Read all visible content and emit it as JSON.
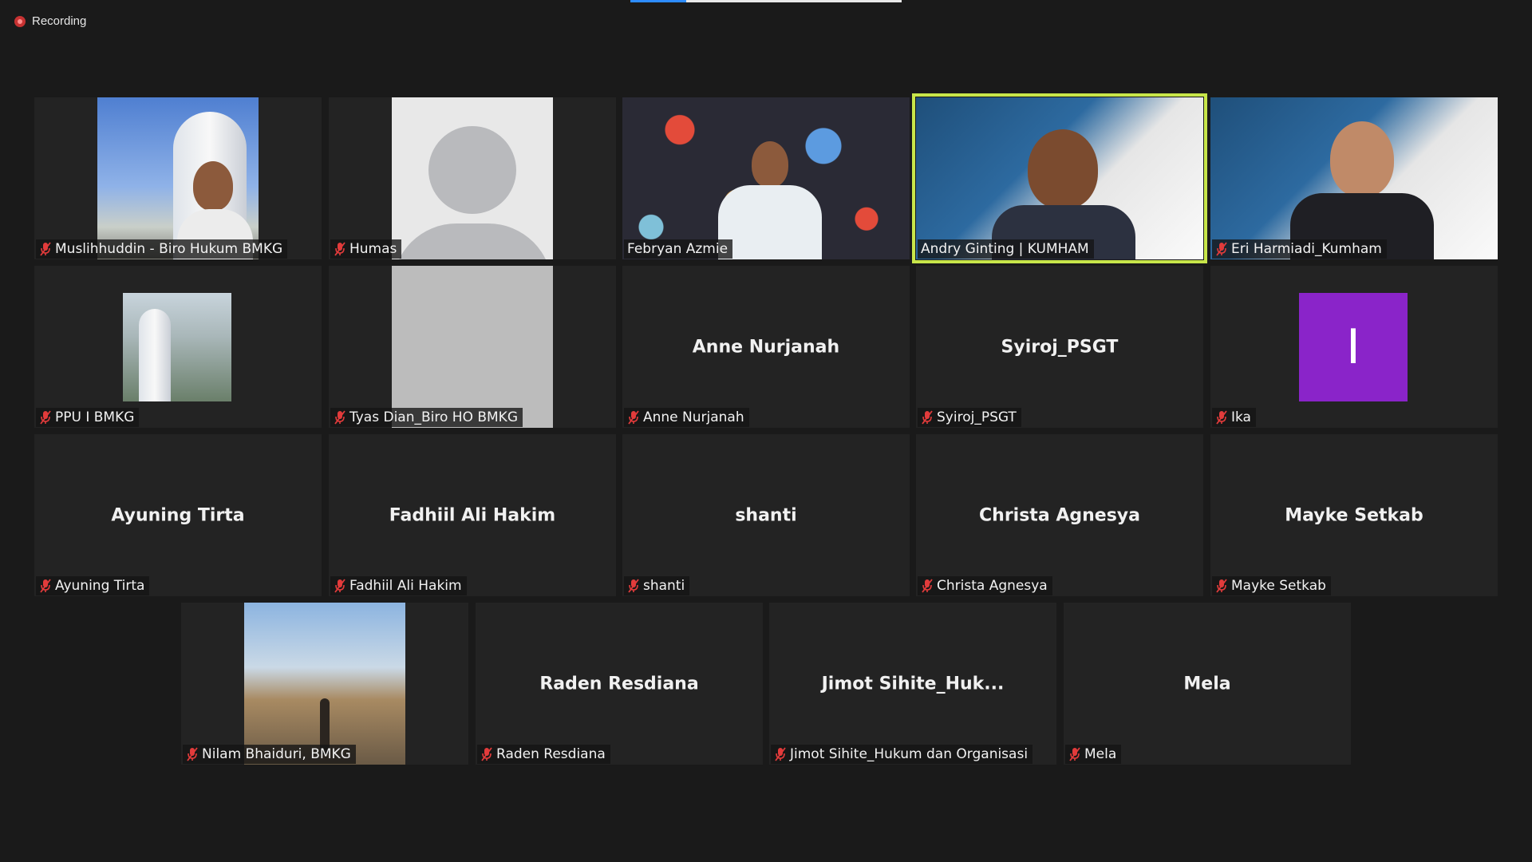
{
  "recording": {
    "label": "Recording"
  },
  "colors": {
    "background": "#1a1a1a",
    "active_speaker_border": "#c8e64a",
    "muted_icon": "#e23b3b",
    "avatar_purple": "#8a24c9"
  },
  "participants": [
    {
      "name": "Muslihhuddin - Biro Hukum BMKG",
      "video": "on",
      "muted": true
    },
    {
      "name": "Humas",
      "video": "avatar",
      "muted": true
    },
    {
      "name": "Febryan Azmie",
      "video": "on",
      "muted": false
    },
    {
      "name": "Andry Ginting | KUMHAM",
      "video": "on",
      "muted": false,
      "active_speaker": true
    },
    {
      "name": "Eri Harmiadi_Kumham",
      "video": "on",
      "muted": true
    },
    {
      "name": "PPU I BMKG",
      "video": "picture",
      "muted": true
    },
    {
      "name": "Tyas Dian_Biro HO BMKG",
      "video": "on",
      "muted": true
    },
    {
      "name": "Anne Nurjanah",
      "display_name": "Anne Nurjanah",
      "video": "off",
      "muted": true
    },
    {
      "name": "Syiroj_PSGT",
      "display_name": "Syiroj_PSGT",
      "video": "off",
      "muted": true
    },
    {
      "name": "Ika",
      "initial": "I",
      "video": "initial",
      "muted": true
    },
    {
      "name": "Ayuning Tirta",
      "display_name": "Ayuning Tirta",
      "video": "off",
      "muted": true
    },
    {
      "name": "Fadhiil Ali Hakim",
      "display_name": "Fadhiil Ali Hakim",
      "video": "off",
      "muted": true
    },
    {
      "name": "shanti",
      "display_name": "shanti",
      "video": "off",
      "muted": true
    },
    {
      "name": "Christa Agnesya",
      "display_name": "Christa Agnesya",
      "video": "off",
      "muted": true
    },
    {
      "name": "Mayke Setkab",
      "display_name": "Mayke Setkab",
      "video": "off",
      "muted": true
    },
    {
      "name": "Nilam Bhaiduri, BMKG",
      "video": "picture",
      "muted": true
    },
    {
      "name": "Raden Resdiana",
      "display_name": "Raden Resdiana",
      "video": "off",
      "muted": true
    },
    {
      "name": "Jimot Sihite_Hukum dan Organisasi",
      "display_name": "Jimot  Sihite_Huk...",
      "video": "off",
      "muted": true
    },
    {
      "name": "Mela",
      "display_name": "Mela",
      "video": "off",
      "muted": true
    }
  ]
}
